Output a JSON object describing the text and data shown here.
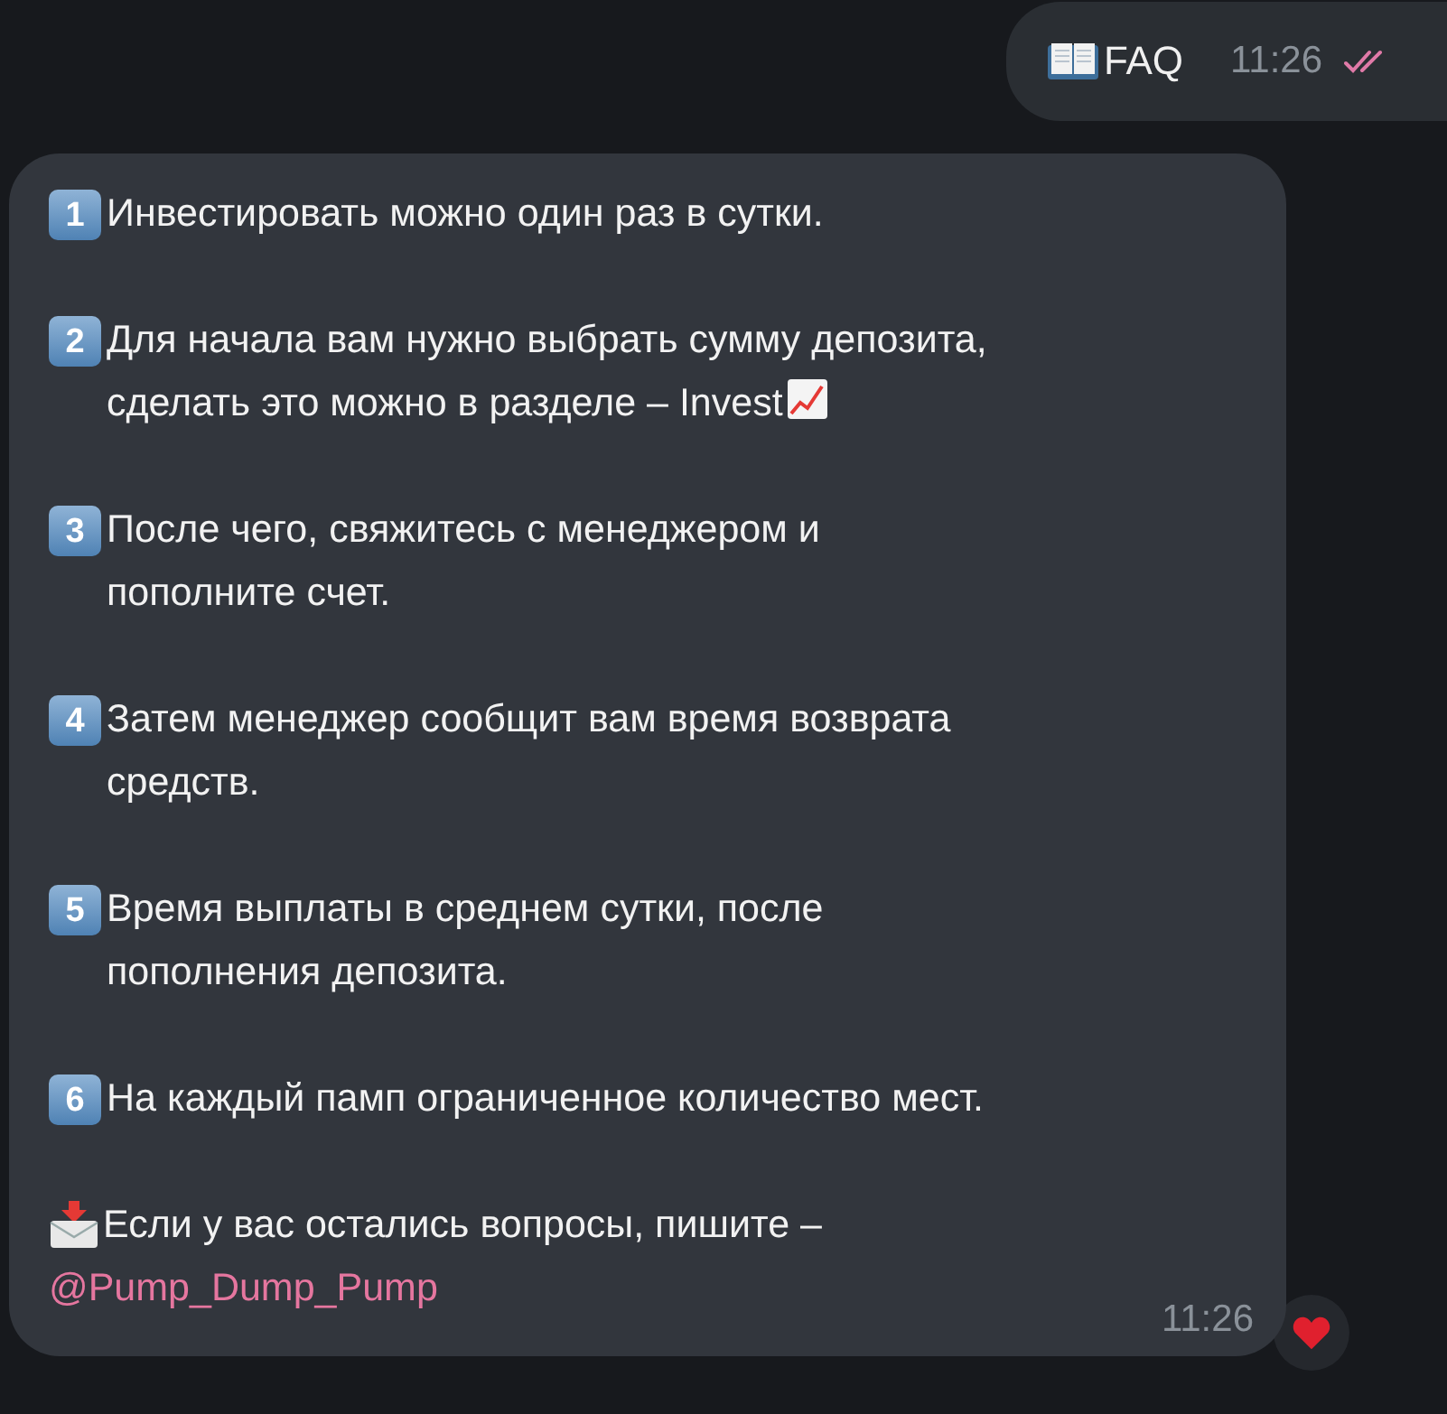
{
  "outgoing": {
    "text": "FAQ",
    "time": "11:26",
    "read": true
  },
  "incoming": {
    "items": [
      {
        "kind": "number",
        "number": "1",
        "lines": [
          "Инвестировать можно один раз в сутки."
        ]
      },
      {
        "kind": "number",
        "number": "2",
        "lines": [
          "Для начала вам нужно выбрать сумму депозита,",
          "сделать это можно в разделе – Invest"
        ],
        "trailing": {
          "kind": "chart"
        }
      },
      {
        "kind": "number",
        "number": "3",
        "lines": [
          "После чего, свяжитесь с менеджером и",
          "пополните счет."
        ]
      },
      {
        "kind": "number",
        "number": "4",
        "lines": [
          "Затем менеджер сообщит вам время возврата",
          "средств."
        ]
      },
      {
        "kind": "number",
        "number": "5",
        "lines": [
          "Время выплаты в среднем сутки, после",
          "пополнения депозита."
        ]
      },
      {
        "kind": "number",
        "number": "6",
        "lines": [
          "На каждый памп ограниченное количество мест."
        ]
      },
      {
        "kind": "envelope",
        "lines": [
          "Если у вас остались вопросы, пишите –"
        ],
        "link": "@Pump_Dump_Pump"
      }
    ],
    "time": "11:26",
    "reaction": {
      "kind": "heart"
    }
  }
}
